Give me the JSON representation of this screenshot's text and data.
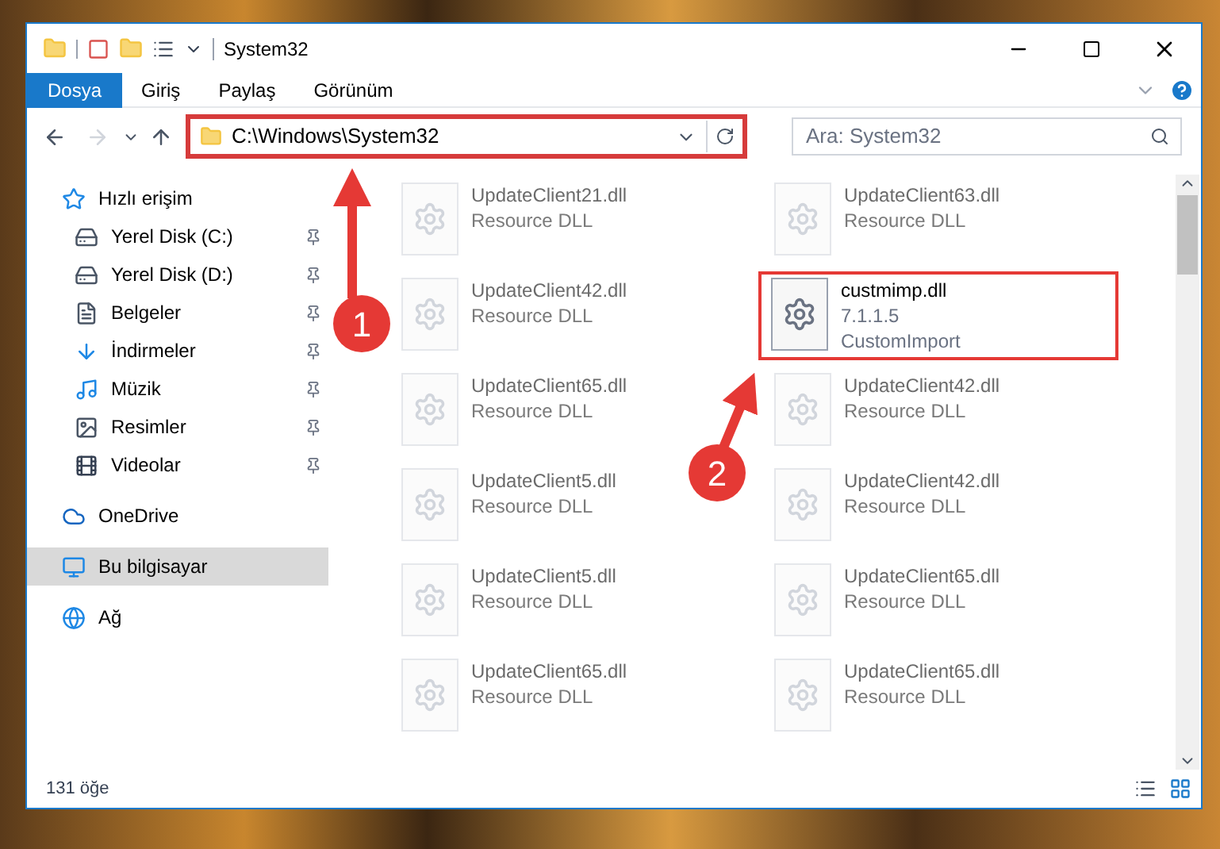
{
  "window": {
    "title": "System32"
  },
  "ribbon_tabs": [
    {
      "label": "Dosya",
      "kind": "file"
    },
    {
      "label": "Giriş",
      "kind": "tab"
    },
    {
      "label": "Paylaş",
      "kind": "tab"
    },
    {
      "label": "Görünüm",
      "kind": "tab"
    }
  ],
  "address_bar": {
    "path": "C:\\Windows\\System32",
    "highlighted": true
  },
  "search": {
    "placeholder": "Ara: System32"
  },
  "sidebar": {
    "items": [
      {
        "label": "Hızlı erişim",
        "selected": false,
        "children": [
          {
            "label": "Yerel Disk (C:)",
            "pinned": true,
            "selected": false
          },
          {
            "label": "Yerel Disk (D:)",
            "pinned": true,
            "selected": false
          },
          {
            "label": "Belgeler",
            "pinned": true,
            "selected": false
          },
          {
            "label": "İndirmeler",
            "pinned": true,
            "selected": false
          },
          {
            "label": "Müzik",
            "pinned": true,
            "selected": false
          },
          {
            "label": "Resimler",
            "pinned": true,
            "selected": false
          },
          {
            "label": "Videolar",
            "pinned": true,
            "selected": false
          }
        ]
      },
      {
        "label": "OneDrive",
        "selected": false
      },
      {
        "label": "Bu bilgisayar",
        "selected": true
      },
      {
        "label": "Ağ",
        "selected": false
      }
    ]
  },
  "files": [
    {
      "name": "UpdateClient21.dll",
      "lines": [
        "Resource DLL"
      ],
      "faded": true,
      "highlighted": false
    },
    {
      "name": "UpdateClient63.dll",
      "lines": [
        "Resource DLL"
      ],
      "faded": true,
      "highlighted": false
    },
    {
      "name": "UpdateClient42.dll",
      "lines": [
        "Resource DLL"
      ],
      "faded": true,
      "highlighted": false
    },
    {
      "name": "custmimp.dll",
      "lines": [
        "7.1.1.5",
        "CustomImport"
      ],
      "faded": false,
      "highlighted": true
    },
    {
      "name": "UpdateClient65.dll",
      "lines": [
        "Resource DLL"
      ],
      "faded": true,
      "highlighted": false
    },
    {
      "name": "UpdateClient42.dll",
      "lines": [
        "Resource DLL"
      ],
      "faded": true,
      "highlighted": false
    },
    {
      "name": "UpdateClient5.dll",
      "lines": [
        "Resource DLL"
      ],
      "faded": true,
      "highlighted": false
    },
    {
      "name": "UpdateClient42.dll",
      "lines": [
        "Resource DLL"
      ],
      "faded": true,
      "highlighted": false
    },
    {
      "name": "UpdateClient5.dll",
      "lines": [
        "Resource DLL"
      ],
      "faded": true,
      "highlighted": false
    },
    {
      "name": "UpdateClient65.dll",
      "lines": [
        "Resource DLL"
      ],
      "faded": true,
      "highlighted": false
    },
    {
      "name": "UpdateClient65.dll",
      "lines": [
        "Resource DLL"
      ],
      "faded": true,
      "highlighted": false
    },
    {
      "name": "UpdateClient65.dll",
      "lines": [
        "Resource DLL"
      ],
      "faded": true,
      "highlighted": false
    }
  ],
  "status_bar": {
    "count": "131 öğe"
  },
  "callouts": [
    {
      "label": "1"
    },
    {
      "label": "2"
    }
  ]
}
